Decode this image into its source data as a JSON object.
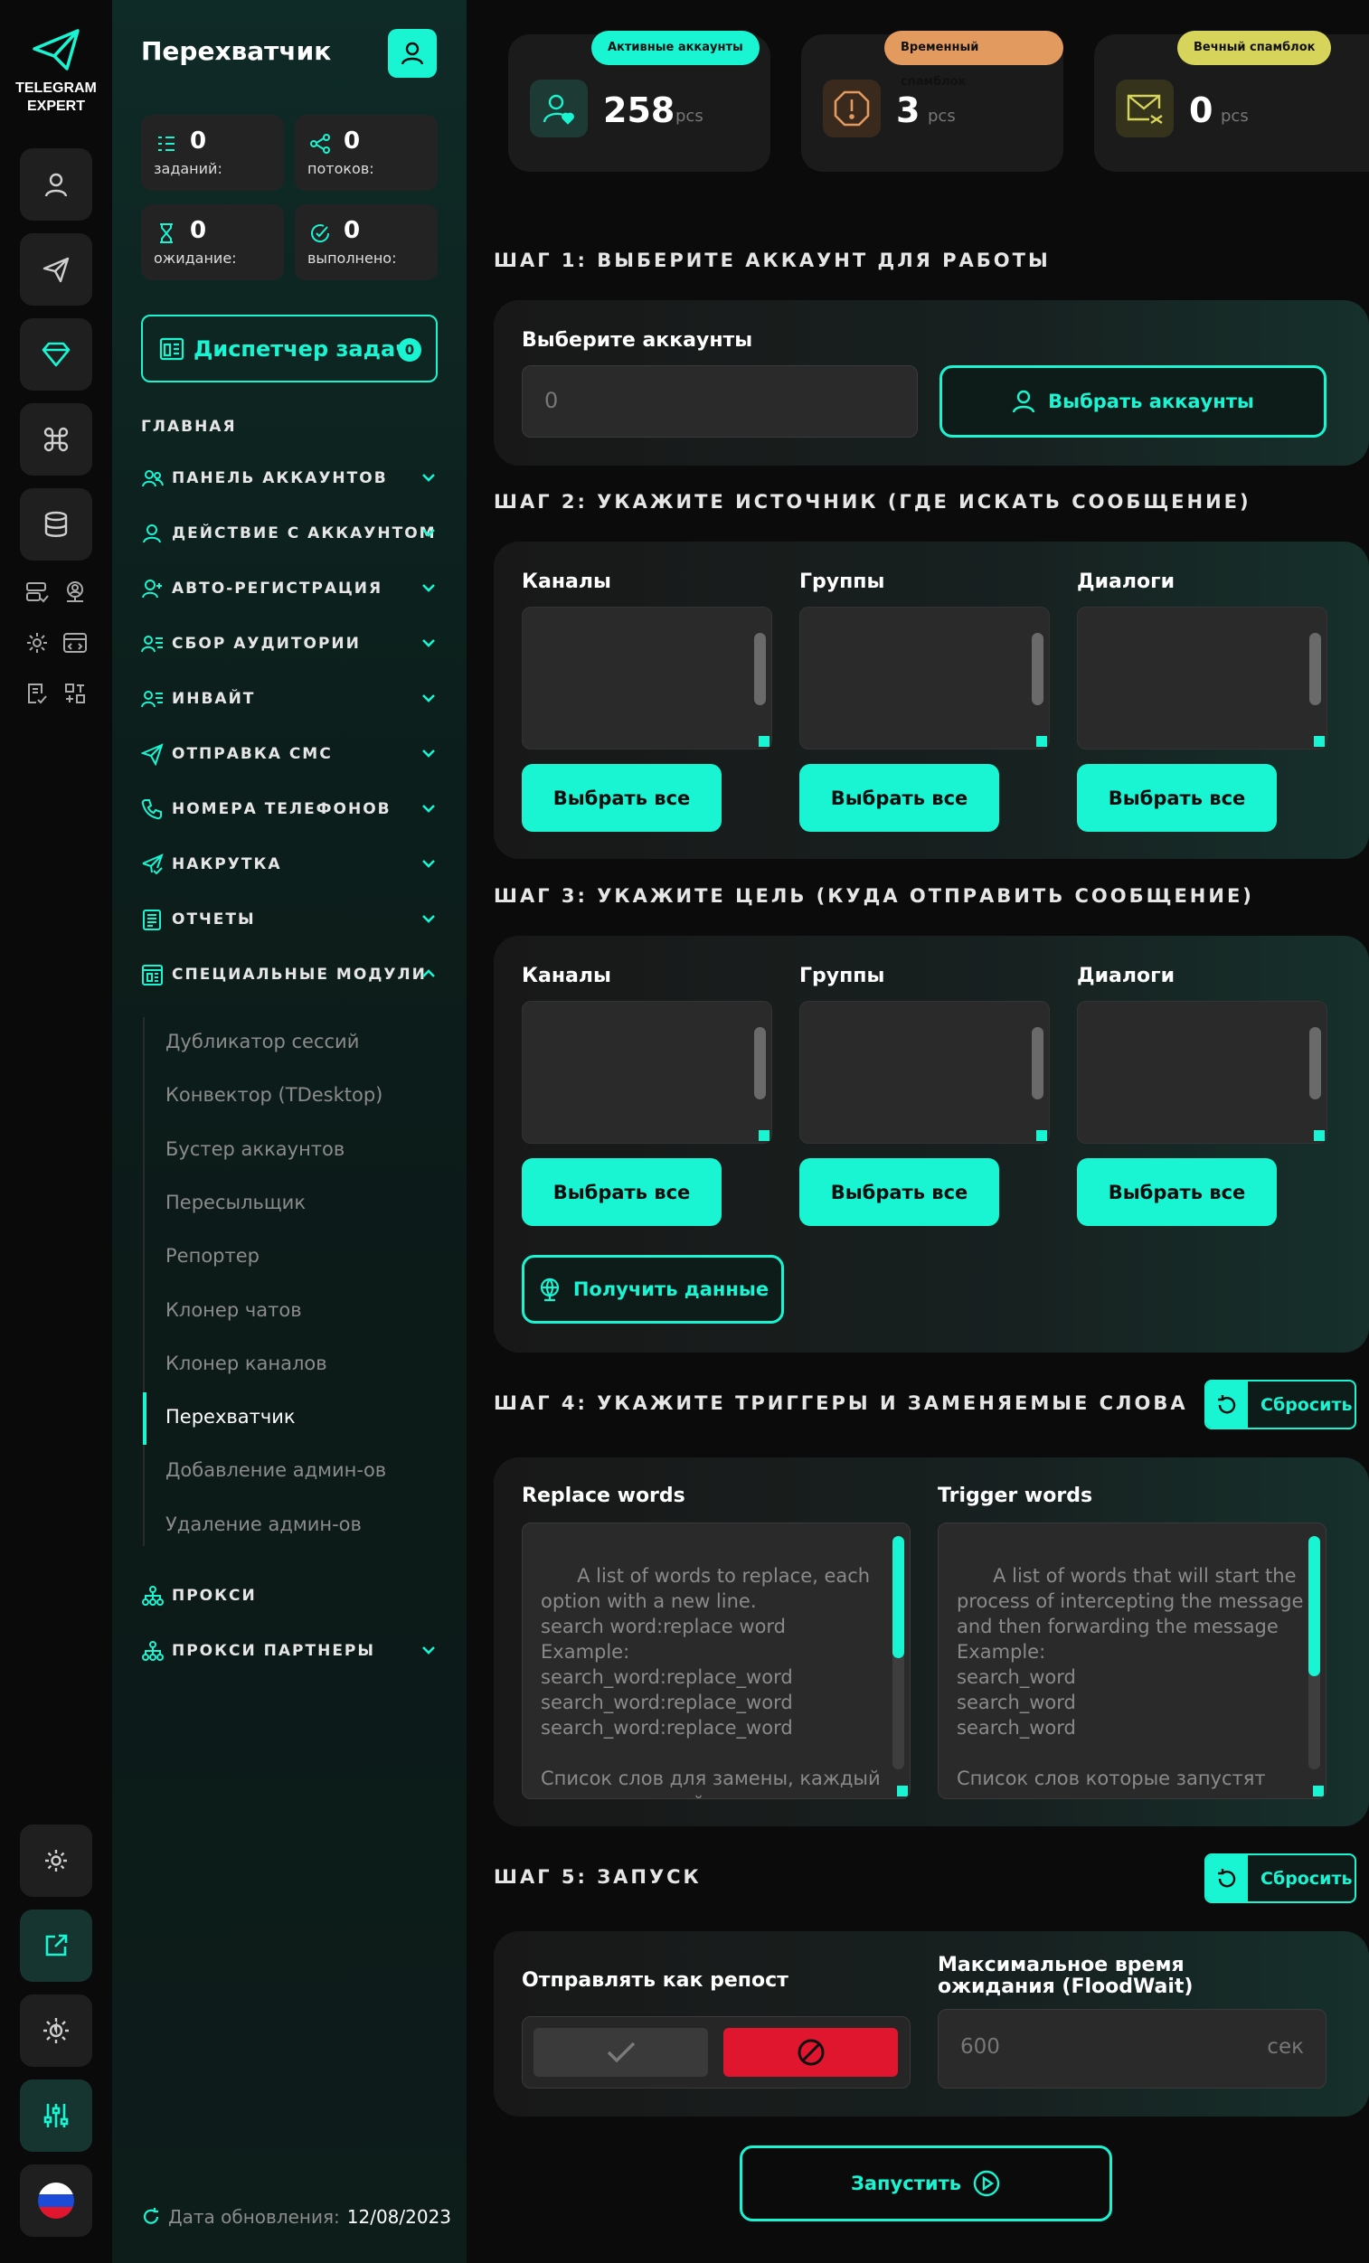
{
  "brand": {
    "line1": "TELEGRAM",
    "line2": "EXPERT"
  },
  "sidebar": {
    "title": "Перехватчик",
    "stats": [
      {
        "value": "0",
        "label": "заданий:"
      },
      {
        "value": "0",
        "label": "потоков:"
      },
      {
        "value": "0",
        "label": "ожидание:"
      },
      {
        "value": "0",
        "label": "выполнено:"
      }
    ],
    "dispatcher": {
      "label": "Диспетчер задач",
      "count": "0"
    },
    "section": "ГЛАВНАЯ",
    "nav": [
      {
        "label": "ПАНЕЛЬ АККАУНТОВ",
        "icon": "users-icon",
        "expanded": false
      },
      {
        "label": "ДЕЙСТВИЕ С АККАУНТОМ",
        "icon": "user-icon",
        "expanded": false
      },
      {
        "label": "АВТО-РЕГИСТРАЦИЯ",
        "icon": "user-plus-icon",
        "expanded": false
      },
      {
        "label": "СБОР АУДИТОРИИ",
        "icon": "user-list-icon",
        "expanded": false
      },
      {
        "label": "ИНВАЙТ",
        "icon": "user-list-icon",
        "expanded": false
      },
      {
        "label": "ОТПРАВКА СМС",
        "icon": "send-icon",
        "expanded": false
      },
      {
        "label": "НОМЕРА ТЕЛЕФОНОВ",
        "icon": "phone-icon",
        "expanded": false
      },
      {
        "label": "НАКРУТКА",
        "icon": "send-check-icon",
        "expanded": false
      },
      {
        "label": "ОТЧЕТЫ",
        "icon": "report-icon",
        "expanded": false
      },
      {
        "label": "СПЕЦИАЛЬНЫЕ МОДУЛИ",
        "icon": "modules-icon",
        "expanded": true
      }
    ],
    "submenu": [
      "Дубликатор сессий",
      "Конвектор (TDesktop)",
      "Бустер аккаунтов",
      "Пересыльщик",
      "Репортер",
      "Клонер чатов",
      "Клонер каналов",
      "Перехватчик",
      "Добавление админ-ов",
      "Удаление админ-ов"
    ],
    "active_submenu": "Перехватчик",
    "nav_bottom": [
      {
        "label": "ПРОКСИ",
        "icon": "network-icon",
        "has_chevron": false
      },
      {
        "label": "ПРОКСИ ПАРТНЕРЫ",
        "icon": "network-icon",
        "has_chevron": true
      }
    ],
    "update": {
      "label": "Дата обновления:",
      "date": "12/08/2023"
    }
  },
  "top_cards": [
    {
      "pill": "Активные аккаунты",
      "value": "258",
      "unit": "pcs",
      "color": "#19f5d2",
      "icon": "user-heart-icon"
    },
    {
      "pill": "Временный спамблок",
      "value": "3",
      "unit": "pcs",
      "color": "#e39a5e",
      "icon": "warning-octagon-icon"
    },
    {
      "pill": "Вечный спамблок",
      "value": "0",
      "unit": "pcs",
      "color": "#d6d45a",
      "icon": "mail-blocked-icon"
    }
  ],
  "step1": {
    "title": "ШАГ 1: ВЫБЕРИТЕ АККАУНТ ДЛЯ РАБОТЫ",
    "label": "Выберите аккаунты",
    "value": "0",
    "button": "Выбрать аккаунты"
  },
  "step2": {
    "title": "ШАГ 2: УКАЖИТЕ ИСТОЧНИК (ГДЕ ИСКАТЬ СООБЩЕНИЕ)",
    "columns": [
      "Каналы",
      "Группы",
      "Диалоги"
    ],
    "button": "Выбрать все"
  },
  "step3": {
    "title": "ШАГ 3: УКАЖИТЕ ЦЕЛЬ (КУДА ОТПРАВИТЬ СООБЩЕНИЕ)",
    "columns": [
      "Каналы",
      "Группы",
      "Диалоги"
    ],
    "button": "Выбрать все",
    "get_data": "Получить данные"
  },
  "step4": {
    "title": "ШАГ 4: УКАЖИТЕ ТРИГГЕРЫ И ЗАМЕНЯЕМЫЕ СЛОВА",
    "reset": "Сбросить",
    "replace_label": "Replace words",
    "replace_placeholder": "A list of words to replace, each option with a new line.\nsearch word:replace word\nExample:\nsearch_word:replace_word\nsearch_word:replace_word\nsearch_word:replace_word\n\nСписок слов для замены, каждый вариант с новой строки.",
    "trigger_label": "Trigger words",
    "trigger_placeholder": "A list of words that will start the process of intercepting the message and then forwarding the message\nExample:\nsearch_word\nsearch_word\nsearch_word\n\nСписок слов которые запустят"
  },
  "step5": {
    "title": "ШАГ 5: ЗАПУСК",
    "reset": "Сбросить",
    "repost_label": "Отправлять как репост",
    "floodwait_label": "Максимальное время ожидания (FloodWait)",
    "floodwait_value": "600",
    "floodwait_unit": "сек"
  },
  "launch": "Запустить",
  "colors": {
    "accent": "#19f5d2",
    "danger": "#e0162f",
    "bg": "#0b0b0b"
  }
}
